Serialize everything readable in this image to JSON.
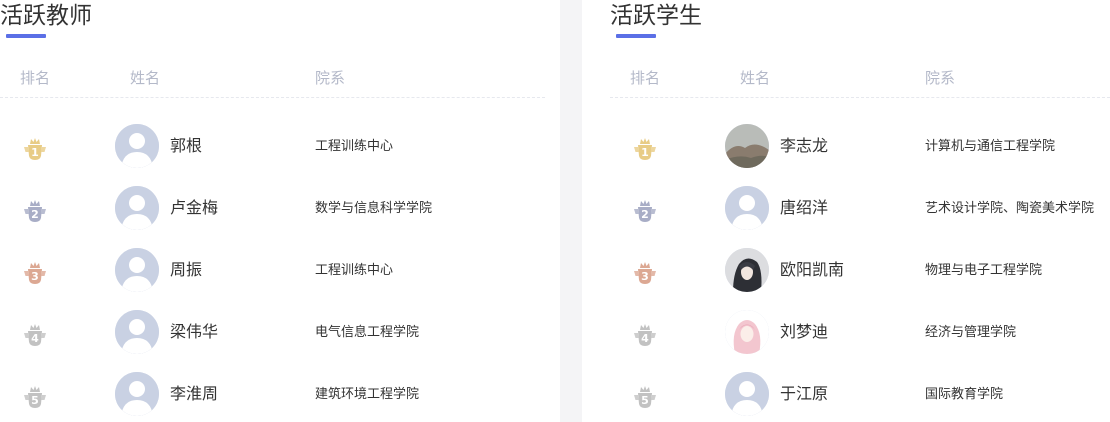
{
  "teachers": {
    "title": "活跃教师",
    "headers": {
      "rank": "排名",
      "name": "姓名",
      "dept": "院系"
    },
    "rows": [
      {
        "rank": "1",
        "name": "郭根",
        "dept": "工程训练中心",
        "avatar": "default"
      },
      {
        "rank": "2",
        "name": "卢金梅",
        "dept": "数学与信息科学学院",
        "avatar": "default"
      },
      {
        "rank": "3",
        "name": "周振",
        "dept": "工程训练中心",
        "avatar": "default"
      },
      {
        "rank": "4",
        "name": "梁伟华",
        "dept": "电气信息工程学院",
        "avatar": "default"
      },
      {
        "rank": "5",
        "name": "李淮周",
        "dept": "建筑环境工程学院",
        "avatar": "default"
      }
    ]
  },
  "students": {
    "title": "活跃学生",
    "headers": {
      "rank": "排名",
      "name": "姓名",
      "dept": "院系"
    },
    "rows": [
      {
        "rank": "1",
        "name": "李志龙",
        "dept": "计算机与通信工程学院",
        "avatar": "landscape-photo"
      },
      {
        "rank": "2",
        "name": "唐绍洋",
        "dept": "艺术设计学院、陶瓷美术学院",
        "avatar": "default"
      },
      {
        "rank": "3",
        "name": "欧阳凯南",
        "dept": "物理与电子工程学院",
        "avatar": "anime-character"
      },
      {
        "rank": "4",
        "name": "刘梦迪",
        "dept": "经济与管理学院",
        "avatar": "anime-girl"
      },
      {
        "rank": "5",
        "name": "于江原",
        "dept": "国际教育学院",
        "avatar": "default"
      }
    ]
  },
  "colors": {
    "accent": "#5b6fe6",
    "rank1": "#e8cc86",
    "rank2": "#a8adc6",
    "rank3": "#dca893",
    "rank4": "#c2c2c2",
    "rank5": "#c2c2c2",
    "header_text": "#b4b9c9"
  }
}
